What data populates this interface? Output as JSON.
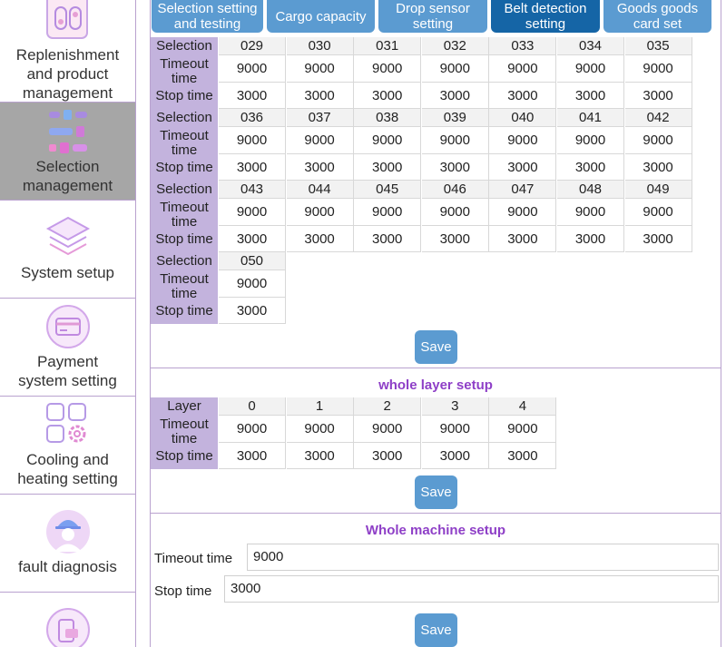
{
  "sidebar": {
    "items": [
      {
        "label": "Replenishment\nand product\nmanagement",
        "icon": "replenishment-icon"
      },
      {
        "label": "Selection\nmanagement",
        "icon": "selection-management-icon",
        "active": true
      },
      {
        "label": "System setup",
        "icon": "layers-icon"
      },
      {
        "label": "Payment\nsystem setting",
        "icon": "payment-card-icon"
      },
      {
        "label": "Cooling and\nheating setting",
        "icon": "grid-gear-icon"
      },
      {
        "label": "fault diagnosis",
        "icon": "worker-icon"
      },
      {
        "label": "",
        "icon": "device-icon"
      }
    ]
  },
  "tabs": [
    {
      "label": "Selection setting and testing"
    },
    {
      "label": "Cargo capacity"
    },
    {
      "label": "Drop sensor setting"
    },
    {
      "label": "Belt detection setting",
      "active": true
    },
    {
      "label": "Goods goods card set"
    }
  ],
  "row_labels": {
    "selection": "Selection",
    "timeout": "Timeout time",
    "stop": "Stop time",
    "layer": "Layer"
  },
  "selection_blocks": [
    {
      "selections": [
        "029",
        "030",
        "031",
        "032",
        "033",
        "034",
        "035"
      ],
      "timeout": [
        "9000",
        "9000",
        "9000",
        "9000",
        "9000",
        "9000",
        "9000"
      ],
      "stop": [
        "3000",
        "3000",
        "3000",
        "3000",
        "3000",
        "3000",
        "3000"
      ]
    },
    {
      "selections": [
        "036",
        "037",
        "038",
        "039",
        "040",
        "041",
        "042"
      ],
      "timeout": [
        "9000",
        "9000",
        "9000",
        "9000",
        "9000",
        "9000",
        "9000"
      ],
      "stop": [
        "3000",
        "3000",
        "3000",
        "3000",
        "3000",
        "3000",
        "3000"
      ]
    },
    {
      "selections": [
        "043",
        "044",
        "045",
        "046",
        "047",
        "048",
        "049"
      ],
      "timeout": [
        "9000",
        "9000",
        "9000",
        "9000",
        "9000",
        "9000",
        "9000"
      ],
      "stop": [
        "3000",
        "3000",
        "3000",
        "3000",
        "3000",
        "3000",
        "3000"
      ]
    },
    {
      "selections": [
        "050"
      ],
      "timeout": [
        "9000"
      ],
      "stop": [
        "3000"
      ]
    }
  ],
  "save_label": "Save",
  "layer_setup": {
    "title": "whole layer setup",
    "layers": [
      "0",
      "1",
      "2",
      "3",
      "4"
    ],
    "timeout": [
      "9000",
      "9000",
      "9000",
      "9000",
      "9000"
    ],
    "stop": [
      "3000",
      "3000",
      "3000",
      "3000",
      "3000"
    ]
  },
  "machine_setup": {
    "title": "Whole machine setup",
    "timeout_label": "Timeout time",
    "timeout_value": "9000",
    "stop_label": "Stop time",
    "stop_value": "3000"
  }
}
